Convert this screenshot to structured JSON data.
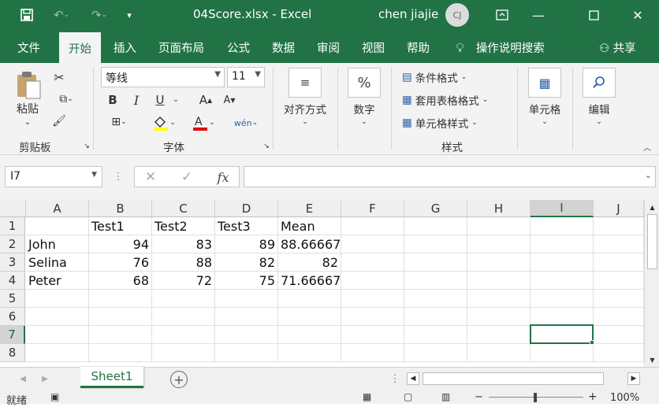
{
  "titlebar": {
    "title": "04Score.xlsx  -  Excel",
    "user": "chen jiajie",
    "avatar_initials": "CJ",
    "icons": [
      "save-icon",
      "undo-icon",
      "redo-icon",
      "customize-qat-icon"
    ]
  },
  "menu": {
    "tabs": [
      "文件",
      "开始",
      "插入",
      "页面布局",
      "公式",
      "数据",
      "审阅",
      "视图",
      "帮助"
    ],
    "active": "开始",
    "tell_me": "操作说明搜索",
    "share": "共享"
  },
  "ribbon": {
    "clipboard": {
      "paste": "粘贴",
      "label": "剪贴板"
    },
    "font": {
      "name": "等线",
      "size": "11",
      "bold": "B",
      "italic": "I",
      "underline": "U",
      "grow": "A",
      "shrink": "A",
      "phonetic": "wén",
      "label": "字体"
    },
    "alignment": {
      "label": "对齐方式"
    },
    "number": {
      "symbol": "%",
      "label": "数字"
    },
    "styles": {
      "conditional": "条件格式",
      "table": "套用表格格式",
      "cell": "单元格样式",
      "label": "样式"
    },
    "cells": {
      "label": "单元格"
    },
    "editing": {
      "label": "编辑"
    }
  },
  "formula_bar": {
    "name_box": "I7",
    "fx": "fx",
    "value": ""
  },
  "sheet": {
    "columns": [
      "A",
      "B",
      "C",
      "D",
      "E",
      "F",
      "G",
      "H",
      "I",
      "J"
    ],
    "selected_col": "I",
    "selected_row": "7",
    "rows": [
      {
        "num": "1",
        "cells": [
          "",
          "Test1",
          "Test2",
          "Test3",
          "Mean"
        ]
      },
      {
        "num": "2",
        "cells": [
          "John",
          "94",
          "83",
          "89",
          "88.66667"
        ]
      },
      {
        "num": "3",
        "cells": [
          "Selina",
          "76",
          "88",
          "82",
          "82"
        ]
      },
      {
        "num": "4",
        "cells": [
          "Peter",
          "68",
          "72",
          "75",
          "71.66667"
        ]
      },
      {
        "num": "5",
        "cells": [
          "",
          "",
          "",
          "",
          ""
        ]
      },
      {
        "num": "6",
        "cells": [
          "",
          "",
          "",
          "",
          ""
        ]
      },
      {
        "num": "7",
        "cells": [
          "",
          "",
          "",
          "",
          ""
        ]
      },
      {
        "num": "8",
        "cells": [
          "",
          "",
          "",
          "",
          ""
        ]
      }
    ]
  },
  "sheet_tabs": {
    "active": "Sheet1"
  },
  "status": {
    "ready": "就绪",
    "zoom": "100%"
  }
}
